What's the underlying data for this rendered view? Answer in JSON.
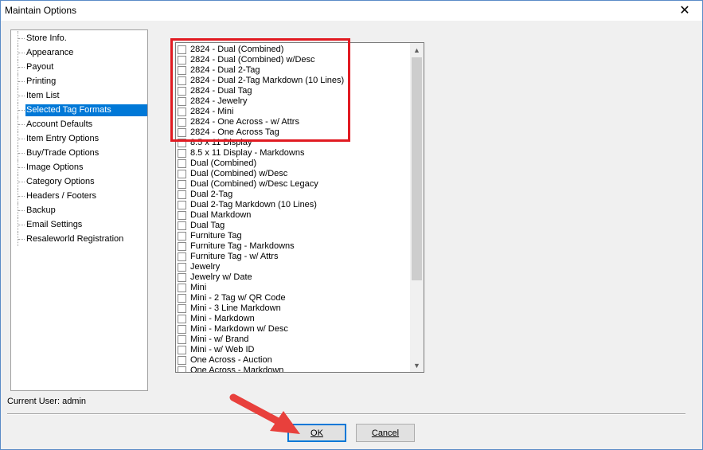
{
  "window": {
    "title": "Maintain Options",
    "close_glyph": "✕"
  },
  "tree": {
    "items": [
      {
        "label": "Store Info.",
        "selected": false
      },
      {
        "label": "Appearance",
        "selected": false
      },
      {
        "label": "Payout",
        "selected": false
      },
      {
        "label": "Printing",
        "selected": false
      },
      {
        "label": "Item List",
        "selected": false
      },
      {
        "label": "Selected Tag Formats",
        "selected": true
      },
      {
        "label": "Account Defaults",
        "selected": false
      },
      {
        "label": "Item Entry Options",
        "selected": false
      },
      {
        "label": "Buy/Trade Options",
        "selected": false
      },
      {
        "label": "Image Options",
        "selected": false
      },
      {
        "label": "Category Options",
        "selected": false
      },
      {
        "label": "Headers / Footers",
        "selected": false
      },
      {
        "label": "Backup",
        "selected": false
      },
      {
        "label": "Email Settings",
        "selected": false
      },
      {
        "label": "Resaleworld Registration",
        "selected": false
      }
    ]
  },
  "tag_formats": {
    "items": [
      {
        "label": "2824 - Dual (Combined)",
        "checked": false
      },
      {
        "label": "2824 - Dual (Combined) w/Desc",
        "checked": false
      },
      {
        "label": "2824 - Dual 2-Tag",
        "checked": false
      },
      {
        "label": "2824 - Dual 2-Tag Markdown (10 Lines)",
        "checked": false
      },
      {
        "label": "2824 - Dual Tag",
        "checked": false
      },
      {
        "label": "2824 - Jewelry",
        "checked": false
      },
      {
        "label": "2824 - Mini",
        "checked": false
      },
      {
        "label": "2824 - One Across - w/ Attrs",
        "checked": false
      },
      {
        "label": "2824 - One Across Tag",
        "checked": false
      },
      {
        "label": "8.5 x 11 Display",
        "checked": false
      },
      {
        "label": "8.5 x 11 Display - Markdowns",
        "checked": false
      },
      {
        "label": "Dual (Combined)",
        "checked": false
      },
      {
        "label": "Dual (Combined) w/Desc",
        "checked": false
      },
      {
        "label": "Dual (Combined) w/Desc Legacy",
        "checked": false
      },
      {
        "label": "Dual 2-Tag",
        "checked": false
      },
      {
        "label": "Dual 2-Tag Markdown (10 Lines)",
        "checked": false
      },
      {
        "label": "Dual Markdown",
        "checked": false
      },
      {
        "label": "Dual Tag",
        "checked": false
      },
      {
        "label": "Furniture Tag",
        "checked": false
      },
      {
        "label": "Furniture Tag - Markdowns",
        "checked": false
      },
      {
        "label": "Furniture Tag - w/ Attrs",
        "checked": false
      },
      {
        "label": "Jewelry",
        "checked": false
      },
      {
        "label": "Jewelry w/ Date",
        "checked": false
      },
      {
        "label": "Mini",
        "checked": false
      },
      {
        "label": "Mini - 2 Tag w/ QR Code",
        "checked": false
      },
      {
        "label": "Mini - 3 Line Markdown",
        "checked": false
      },
      {
        "label": "Mini - Markdown",
        "checked": false
      },
      {
        "label": "Mini - Markdown w/ Desc",
        "checked": false
      },
      {
        "label": "Mini - w/ Brand",
        "checked": false
      },
      {
        "label": "Mini - w/ Web ID",
        "checked": false
      },
      {
        "label": "One Across - Auction",
        "checked": false
      },
      {
        "label": "One Across - Markdown",
        "checked": false
      }
    ],
    "scroll_up_glyph": "▲",
    "scroll_down_glyph": "▼"
  },
  "status": {
    "current_user": "Current User: admin"
  },
  "buttons": {
    "ok": "OK",
    "cancel": "Cancel"
  },
  "colors": {
    "highlight": "#e11b22",
    "arrow": "#e8403c",
    "selection": "#0078d7"
  }
}
